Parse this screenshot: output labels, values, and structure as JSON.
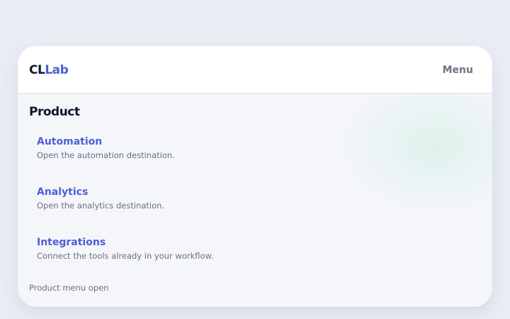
{
  "header": {
    "logo_part1": "CL",
    "logo_part2": "Lab",
    "menu_label": "Menu"
  },
  "menu": {
    "section_title": "Product",
    "items": [
      {
        "title": "Automation",
        "description": "Open the automation destination."
      },
      {
        "title": "Analytics",
        "description": "Open the analytics destination."
      },
      {
        "title": "Integrations",
        "description": "Connect the tools already in your workflow."
      }
    ],
    "status": "Product menu open"
  },
  "colors": {
    "accent": "#4d5fd6",
    "text_dark": "#10172e",
    "text_muted": "#687083",
    "background": "#eaedf4"
  }
}
